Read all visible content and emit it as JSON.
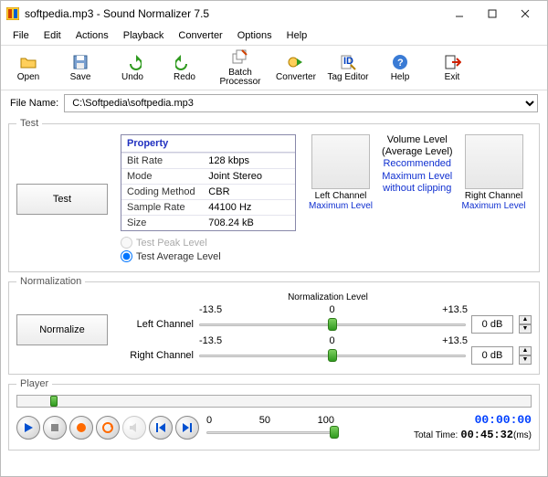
{
  "window": {
    "title": "softpedia.mp3 - Sound Normalizer 7.5"
  },
  "menu": {
    "items": [
      "File",
      "Edit",
      "Actions",
      "Playback",
      "Converter",
      "Options",
      "Help"
    ]
  },
  "toolbar": {
    "open": "Open",
    "save": "Save",
    "undo": "Undo",
    "redo": "Redo",
    "batch": "Batch\nProcessor",
    "converter": "Converter",
    "tageditor": "Tag Editor",
    "help": "Help",
    "exit": "Exit"
  },
  "file": {
    "label": "File Name:",
    "value": "C:\\Softpedia\\softpedia.mp3"
  },
  "test": {
    "legend": "Test",
    "button": "Test",
    "prop_header": "Property",
    "props": [
      {
        "k": "Bit Rate",
        "v": "128 kbps"
      },
      {
        "k": "Mode",
        "v": "Joint Stereo"
      },
      {
        "k": "Coding Method",
        "v": "CBR"
      },
      {
        "k": "Sample Rate",
        "v": "44100 Hz"
      },
      {
        "k": "Size",
        "v": "708.24 kB"
      }
    ],
    "radio_peak": "Test Peak Level",
    "radio_avg": "Test Average Level",
    "left_channel": "Left Channel",
    "right_channel": "Right Channel",
    "max_level": "Maximum Level",
    "vol_title": "Volume Level",
    "vol_sub": "(Average Level)",
    "vol_rec1": "Recommended",
    "vol_rec2": "Maximum Level",
    "vol_rec3": "without clipping"
  },
  "norm": {
    "legend": "Normalization",
    "button": "Normalize",
    "title": "Normalization Level",
    "tick_low": "-13.5",
    "tick_mid": "0",
    "tick_high": "+13.5",
    "left": "Left Channel",
    "right": "Right Channel",
    "left_db": "0 dB",
    "right_db": "0 dB"
  },
  "player": {
    "legend": "Player",
    "tick0": "0",
    "tick50": "50",
    "tick100": "100",
    "total_label": "Total Time:",
    "elapsed": "00:00:00",
    "total": "00:45:32",
    "ms": "(ms)"
  }
}
